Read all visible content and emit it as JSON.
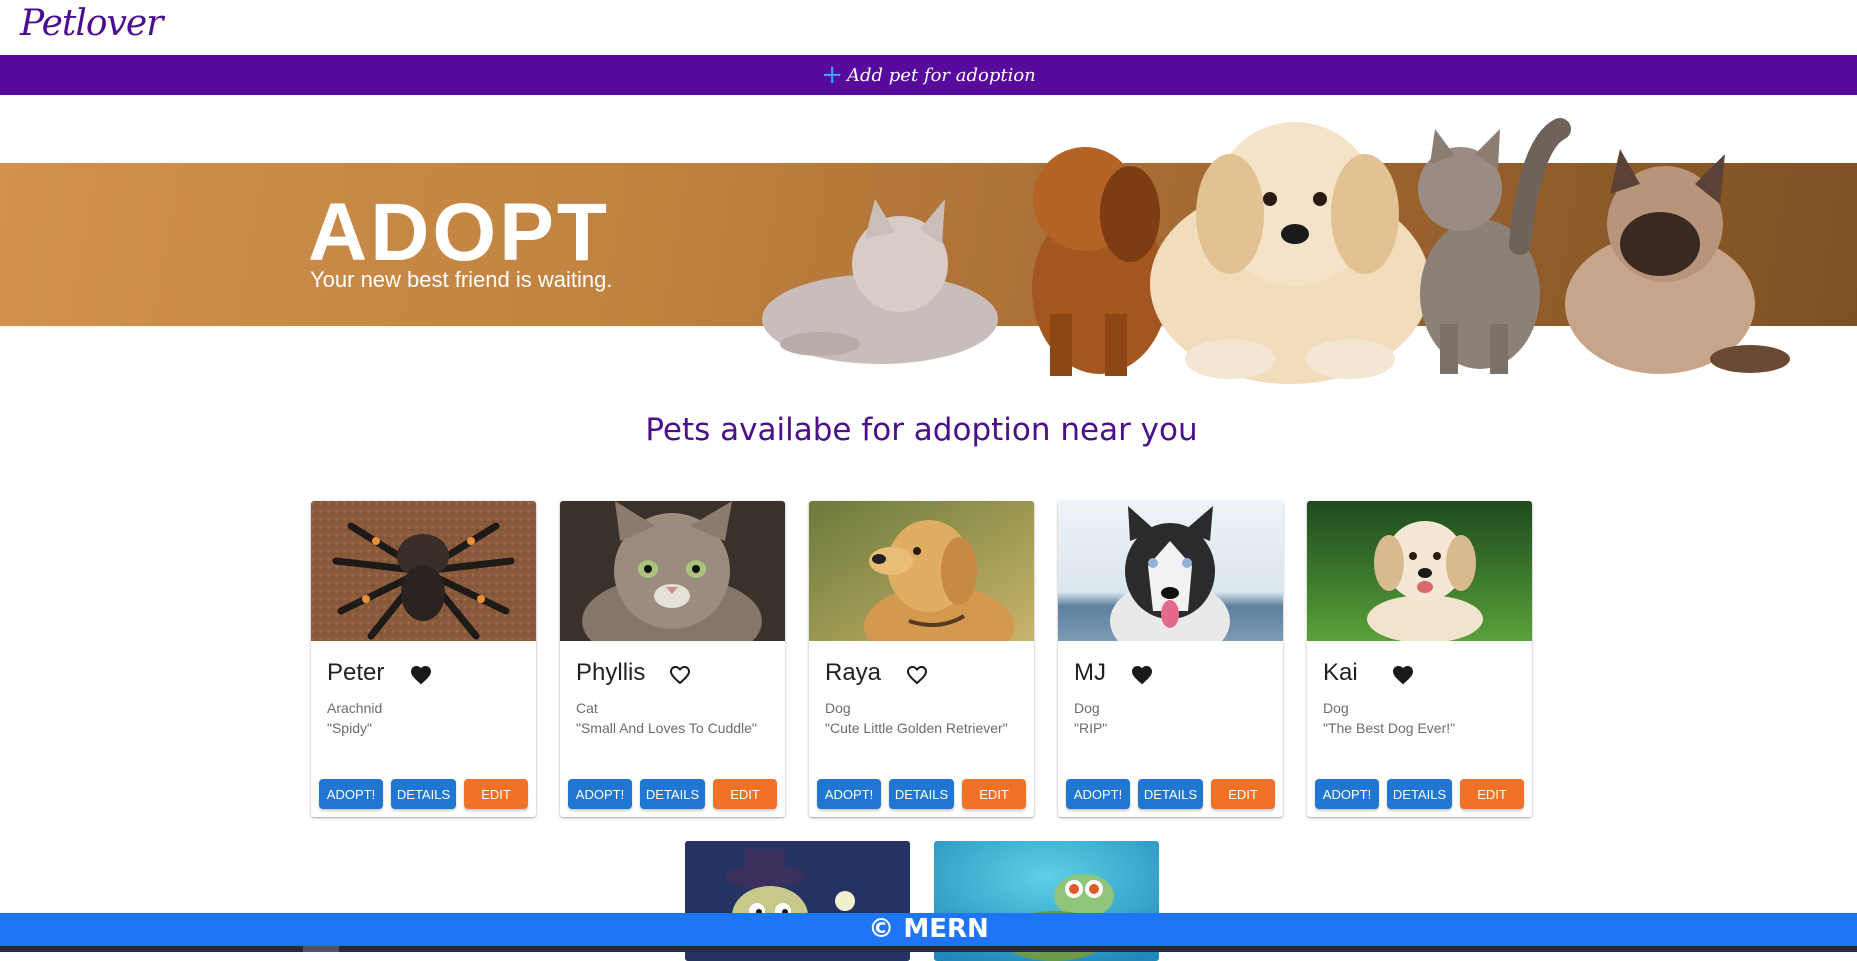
{
  "header": {
    "logo": "Petlover"
  },
  "add_bar": {
    "label": "Add pet for adoption",
    "icon": "plus-icon"
  },
  "hero": {
    "title": "ADOPT",
    "subtitle": "Your new best friend is waiting."
  },
  "section_title": "Pets availabe for adoption near you",
  "buttons": {
    "adopt": "ADOPT!",
    "details": "DETAILS",
    "edit": "EDIT"
  },
  "cards": [
    {
      "name": "Peter",
      "species": "Arachnid",
      "quote": "\"Spidy\"",
      "favorited": true
    },
    {
      "name": "Phyllis",
      "species": "Cat",
      "quote": "\"Small And Loves To Cuddle\"",
      "favorited": false
    },
    {
      "name": "Raya",
      "species": "Dog",
      "quote": "\"Cute Little Golden Retriever\"",
      "favorited": false
    },
    {
      "name": "MJ",
      "species": "Dog",
      "quote": "\"RIP\"",
      "favorited": true
    },
    {
      "name": "Kai",
      "species": "Dog",
      "quote": "\"The Best Dog Ever!\"",
      "favorited": true
    }
  ],
  "footer": {
    "text": "© MERN"
  },
  "colors": {
    "brand_purple": "#560a9e",
    "button_blue": "#2176d2",
    "button_orange": "#f07226",
    "footer_blue": "#1e75f5"
  }
}
